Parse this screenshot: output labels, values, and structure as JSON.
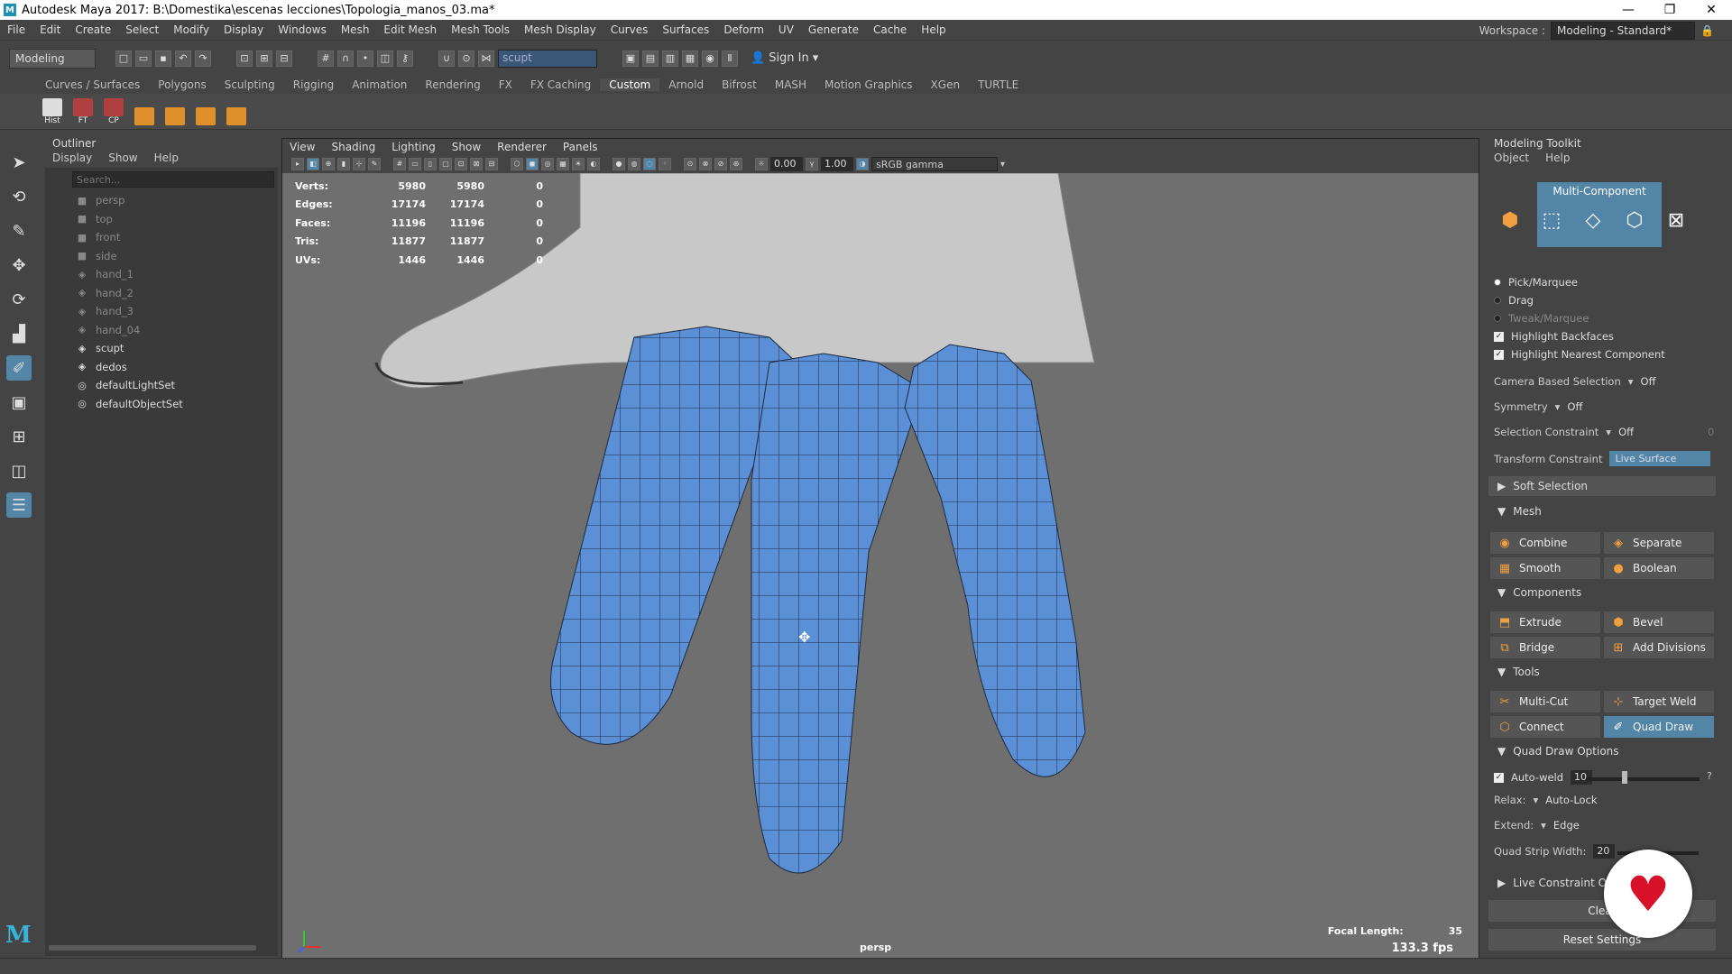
{
  "window": {
    "title": "Autodesk Maya 2017: B:\\Domestika\\escenas lecciones\\Topologia_manos_03.ma*",
    "logo": "M",
    "minimize": "—",
    "restore": "❐",
    "close": "✕"
  },
  "menus": [
    "File",
    "Edit",
    "Create",
    "Select",
    "Modify",
    "Display",
    "Windows",
    "Mesh",
    "Edit Mesh",
    "Mesh Tools",
    "Mesh Display",
    "Curves",
    "Surfaces",
    "Deform",
    "UV",
    "Generate",
    "Cache",
    "Help"
  ],
  "workspace": {
    "label": "Workspace :",
    "value": "Modeling - Standard*"
  },
  "statusline": {
    "mode": "Modeling",
    "search_value": "scupt",
    "sign_in": "Sign In"
  },
  "shelf_tabs": [
    "Curves / Surfaces",
    "Polygons",
    "Sculpting",
    "Rigging",
    "Animation",
    "Rendering",
    "FX",
    "FX Caching",
    "Custom",
    "Arnold",
    "Bifrost",
    "MASH",
    "Motion Graphics",
    "XGen",
    "TURTLE"
  ],
  "shelf_active": "Custom",
  "shelf_items": [
    {
      "label": "Hist",
      "color": "#dddddd",
      "icon": "history-icon"
    },
    {
      "label": "FT",
      "color": "#b04040",
      "icon": "freeze-transform-icon"
    },
    {
      "label": "CP",
      "color": "#b04040",
      "icon": "center-pivot-icon"
    },
    {
      "label": "",
      "color": "#e0902a",
      "icon": "pivot-icon"
    },
    {
      "label": "",
      "color": "#e0902a",
      "icon": "duplicate-icon"
    },
    {
      "label": "",
      "color": "#e0902a",
      "icon": "cube-icon"
    },
    {
      "label": "",
      "color": "#e0902a",
      "icon": "grid-icon"
    }
  ],
  "outliner": {
    "title": "Outliner",
    "menu": [
      "Display",
      "Show",
      "Help"
    ],
    "search_placeholder": "Search...",
    "items": [
      {
        "name": "persp",
        "icon": "camera-icon",
        "dim": true
      },
      {
        "name": "top",
        "icon": "camera-icon",
        "dim": true
      },
      {
        "name": "front",
        "icon": "camera-icon",
        "dim": true
      },
      {
        "name": "side",
        "icon": "camera-icon",
        "dim": true
      },
      {
        "name": "hand_1",
        "icon": "mesh-icon",
        "dim": true
      },
      {
        "name": "hand_2",
        "icon": "mesh-icon",
        "dim": true
      },
      {
        "name": "hand_3",
        "icon": "mesh-icon",
        "dim": true
      },
      {
        "name": "hand_04",
        "icon": "mesh-icon",
        "dim": true
      },
      {
        "name": "scupt",
        "icon": "mesh-icon",
        "dim": false
      },
      {
        "name": "dedos",
        "icon": "mesh-icon",
        "dim": false
      },
      {
        "name": "defaultLightSet",
        "icon": "set-icon",
        "dim": false
      },
      {
        "name": "defaultObjectSet",
        "icon": "set-icon",
        "dim": false
      }
    ]
  },
  "viewport": {
    "menu": [
      "View",
      "Shading",
      "Lighting",
      "Show",
      "Renderer",
      "Panels"
    ],
    "exposure": "0.00",
    "gamma_value": "1.00",
    "color_space": "sRGB gamma",
    "hud": [
      {
        "label": "Verts:",
        "a": "5980",
        "b": "5980",
        "c": "0"
      },
      {
        "label": "Edges:",
        "a": "17174",
        "b": "17174",
        "c": "0"
      },
      {
        "label": "Faces:",
        "a": "11196",
        "b": "11196",
        "c": "0"
      },
      {
        "label": "Tris:",
        "a": "11877",
        "b": "11877",
        "c": "0"
      },
      {
        "label": "UVs:",
        "a": "1446",
        "b": "1446",
        "c": "0"
      }
    ],
    "focal_label": "Focal Length:",
    "focal_value": "35",
    "fps": "133.3 fps",
    "camera": "persp",
    "mesh_color": "#5b8fd6"
  },
  "toolkit": {
    "title": "Modeling Toolkit",
    "menu": [
      "Object",
      "Help"
    ],
    "mode": "Multi-Component",
    "selection_modes": [
      "Pick/Marquee",
      "Drag",
      "Tweak/Marquee"
    ],
    "checks": [
      "Highlight Backfaces",
      "Highlight Nearest Component"
    ],
    "camera_based": {
      "label": "Camera Based Selection",
      "value": "Off"
    },
    "symmetry": {
      "label": "Symmetry",
      "value": "Off"
    },
    "sel_constraint": {
      "label": "Selection Constraint",
      "value": "Off",
      "extra": "0"
    },
    "transform_constraint": {
      "label": "Transform Constraint",
      "value": "Live Surface"
    },
    "soft_selection": "Soft Selection",
    "sections": {
      "mesh": "Mesh",
      "components": "Components",
      "tools": "Tools",
      "quad_draw": "Quad Draw Options",
      "live_constraint": "Live Constraint Op"
    },
    "mesh_buttons": [
      "Combine",
      "Separate",
      "Smooth",
      "Boolean"
    ],
    "component_buttons": [
      "Extrude",
      "Bevel",
      "Bridge",
      "Add Divisions"
    ],
    "tool_buttons": [
      "Multi-Cut",
      "Target Weld",
      "Connect",
      "Quad Draw"
    ],
    "auto_weld": {
      "label": "Auto-weld",
      "value": "10",
      "help": "?"
    },
    "relax": {
      "label": "Relax:",
      "value": "Auto-Lock"
    },
    "extend": {
      "label": "Extend:",
      "value": "Edge"
    },
    "quad_strip": {
      "label": "Quad Strip Width:",
      "value": "20"
    },
    "clear": "Clear",
    "reset": "Reset Settings"
  }
}
